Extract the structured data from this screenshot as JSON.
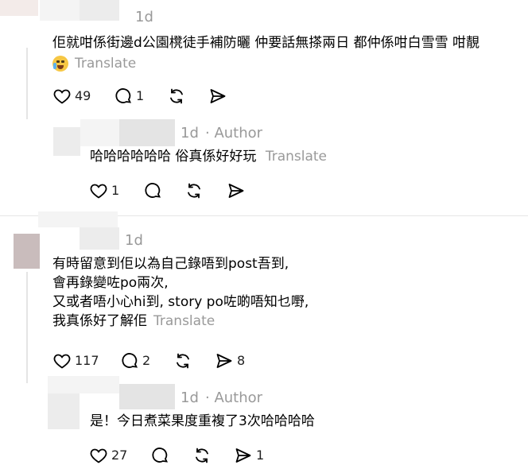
{
  "posts": [
    {
      "time": "1d",
      "lines": [
        "佢就咁係街邊d公園櫈徒手補防曬 仲要話無搽兩日 都仲係咁白雪雪 咁靚"
      ],
      "translate": "Translate",
      "likes": "49",
      "replies": "1",
      "reposts": "",
      "shares": ""
    },
    {
      "time": "1d",
      "author": "· Author",
      "lines": [
        "哈哈哈哈哈哈 俗真係好好玩"
      ],
      "translate": "Translate",
      "likes": "1",
      "replies": "",
      "reposts": "",
      "shares": ""
    },
    {
      "time": "1d",
      "lines": [
        "有時留意到佢以為自己錄唔到post吾到,",
        "會再錄變咗po兩次,",
        "又或者唔小心hi到, story po咗啲唔知乜嘢,",
        "我真係好了解佢"
      ],
      "translate": "Translate",
      "likes": "117",
      "replies": "2",
      "reposts": "",
      "shares": "8"
    },
    {
      "time": "1d",
      "author": "· Author",
      "lines": [
        "是！今日煮菜果度重複了3次哈哈哈哈"
      ],
      "likes": "27",
      "replies": "",
      "reposts": "",
      "shares": "1"
    }
  ],
  "icons": [
    "heart-icon",
    "comment-icon",
    "repost-icon",
    "share-icon",
    "loudly-crying-face-emoji"
  ]
}
